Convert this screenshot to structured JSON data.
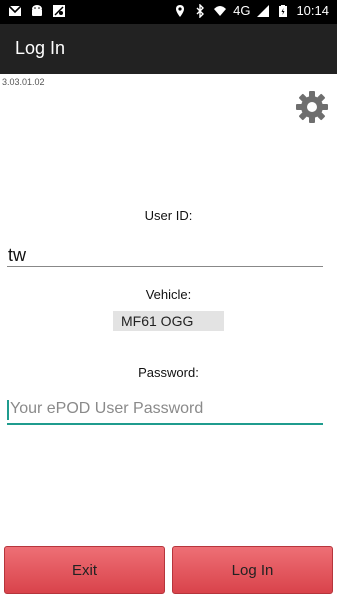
{
  "status_bar": {
    "left_icons": [
      "gmail-icon",
      "android-icon",
      "map-icon"
    ],
    "right_icons": [
      "location-icon",
      "bluetooth-icon",
      "wifi-icon"
    ],
    "network": "4G",
    "time": "10:14"
  },
  "app_bar": {
    "title": "Log In"
  },
  "version": "3.03.01.02",
  "settings_icon": "gear-icon",
  "form": {
    "user_id_label": "User ID:",
    "user_id_value": "tw",
    "vehicle_label": "Vehicle:",
    "vehicle_value": "MF61 OGG",
    "password_label": "Password:",
    "password_placeholder": "Your ePOD User Password"
  },
  "buttons": {
    "exit": "Exit",
    "login": "Log In"
  },
  "colors": {
    "accent": "#1f9c8e",
    "button": "#e0555c",
    "app_bar": "#222222"
  }
}
